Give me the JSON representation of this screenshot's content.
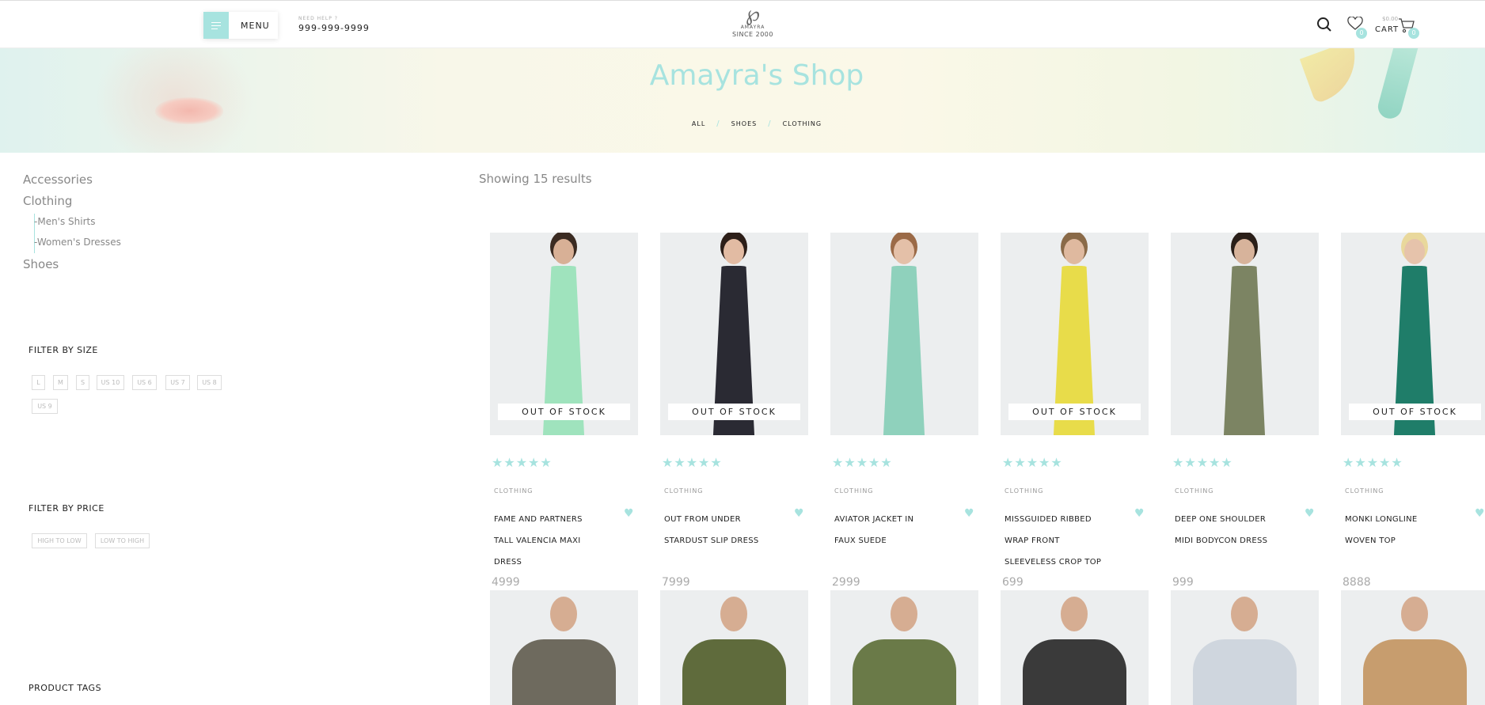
{
  "header": {
    "menu_label": "MENU",
    "help_label": "NEED HELP ?",
    "phone": "999-999-9999",
    "logo_since": "SINCE 2000",
    "logo_brand": "AMAYRA",
    "wishlist_count": "0",
    "cart_label": "CART",
    "cart_total": "$0.00",
    "cart_count": "0"
  },
  "hero": {
    "title": "Amayra's Shop",
    "breadcrumbs": [
      "ALL",
      "SHOES",
      "CLOTHING"
    ]
  },
  "sidebar": {
    "categories": [
      "Accessories",
      "Clothing",
      "Shoes"
    ],
    "subcategories": [
      "Men's Shirts",
      "Women's Dresses"
    ],
    "size_heading": "FILTER BY SIZE",
    "sizes": [
      "L",
      "M",
      "S",
      "US 10",
      "US 6",
      "US 7",
      "US 8",
      "US 9"
    ],
    "price_heading": "FILTER BY PRICE",
    "price_options": [
      "HIGH TO LOW",
      "LOW TO HIGH"
    ],
    "tags_heading": "PRODUCT TAGS"
  },
  "results_text": "Showing 15 results",
  "out_of_stock_label": "OUT OF STOCK",
  "stars": "★★★★★",
  "products": [
    {
      "category": "CLOTHING",
      "name_lines": [
        "FAME AND PARTNERS",
        "TALL VALENCIA MAXI",
        "DRESS"
      ],
      "price": "4999",
      "out_of_stock": true
    },
    {
      "category": "CLOTHING",
      "name_lines": [
        "OUT FROM UNDER",
        "STARDUST SLIP DRESS"
      ],
      "price": "7999",
      "out_of_stock": true
    },
    {
      "category": "CLOTHING",
      "name_lines": [
        "AVIATOR JACKET IN",
        "FAUX SUEDE"
      ],
      "price": "2999",
      "out_of_stock": false
    },
    {
      "category": "CLOTHING",
      "name_lines": [
        "MISSGUIDED RIBBED",
        "WRAP FRONT",
        "SLEEVELESS CROP TOP"
      ],
      "price": "699",
      "out_of_stock": true
    },
    {
      "category": "CLOTHING",
      "name_lines": [
        "DEEP ONE SHOULDER",
        "MIDI BODYCON DRESS"
      ],
      "price": "999",
      "out_of_stock": false
    },
    {
      "category": "CLOTHING",
      "name_lines": [
        "MONKI LONGLINE",
        "WOVEN TOP"
      ],
      "price": "8888",
      "out_of_stock": true
    }
  ],
  "colors": {
    "accent": "#a7e3df"
  }
}
